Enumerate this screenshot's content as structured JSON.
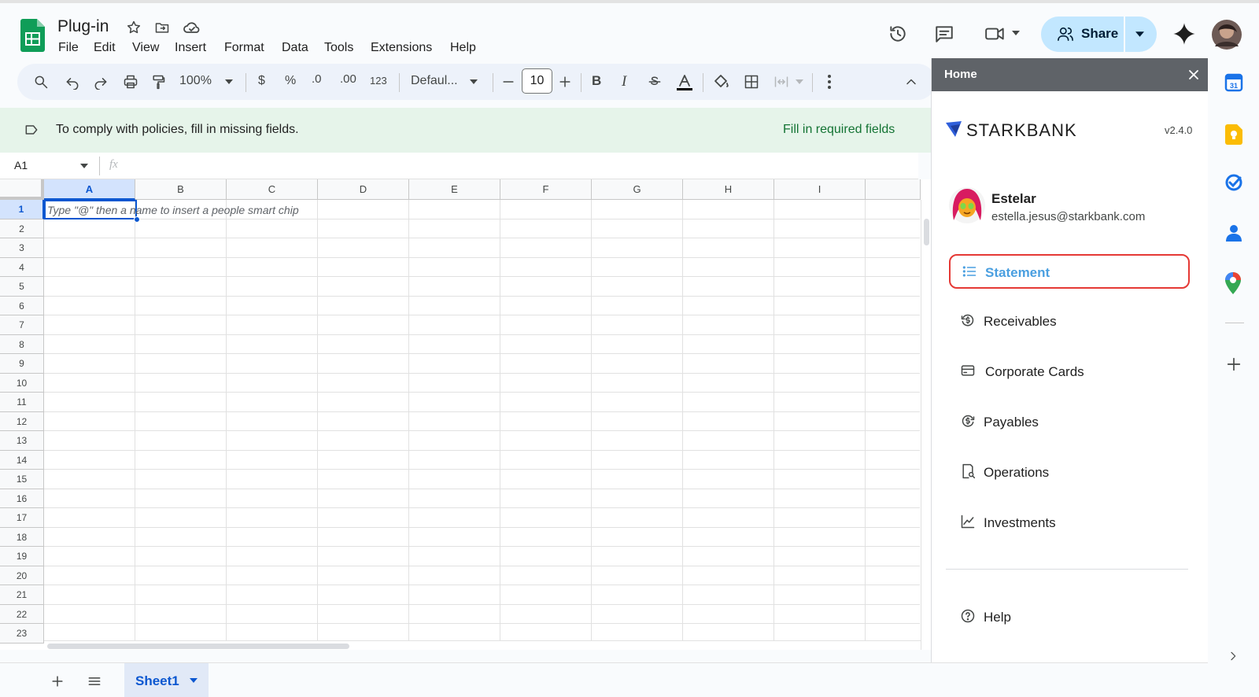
{
  "document": {
    "title": "Plug-in",
    "menu": [
      "File",
      "Edit",
      "View",
      "Insert",
      "Format",
      "Data",
      "Tools",
      "Extensions",
      "Help"
    ]
  },
  "header": {
    "share_label": "Share"
  },
  "toolbar": {
    "zoom": "100%",
    "currency": "$",
    "percent": "%",
    "decrease_decimal": ".0",
    "increase_decimal": ".00",
    "number_format": "123",
    "font": "Defaul...",
    "font_size": "10",
    "bold": "B",
    "italic": "I"
  },
  "banner": {
    "message": "To comply with policies, fill in missing fields.",
    "action": "Fill in required fields"
  },
  "formula_bar": {
    "cell_ref": "A1",
    "fx": "fx"
  },
  "grid": {
    "columns": [
      "A",
      "B",
      "C",
      "D",
      "E",
      "F",
      "G",
      "H",
      "I"
    ],
    "rows": [
      "1",
      "2",
      "3",
      "4",
      "5",
      "6",
      "7",
      "8",
      "9",
      "10",
      "11",
      "12",
      "13",
      "14",
      "15",
      "16",
      "17",
      "18",
      "19",
      "20",
      "21",
      "22",
      "23"
    ],
    "a1_hint": "Type \"@\" then a name to insert a people smart chip"
  },
  "sheets": {
    "active": "Sheet1"
  },
  "sidebar": {
    "title": "Home",
    "brand": "STARKBANK",
    "version": "v2.4.0",
    "user": {
      "name": "Estelar",
      "email": "estella.jesus@starkbank.com"
    },
    "nav": [
      {
        "label": "Statement",
        "icon": "list-icon"
      },
      {
        "label": "Receivables",
        "icon": "receivables-icon"
      },
      {
        "label": "Corporate Cards",
        "icon": "card-icon"
      },
      {
        "label": "Payables",
        "icon": "payables-icon"
      },
      {
        "label": "Operations",
        "icon": "operations-icon"
      },
      {
        "label": "Investments",
        "icon": "chart-line-icon"
      }
    ],
    "help": "Help"
  },
  "colors": {
    "sheets_green": "#0f9d58",
    "share_bg": "#c2e7ff",
    "selection": "#0b57d0",
    "highlight_border": "#e53935",
    "statement_text": "#4a9fe0"
  }
}
